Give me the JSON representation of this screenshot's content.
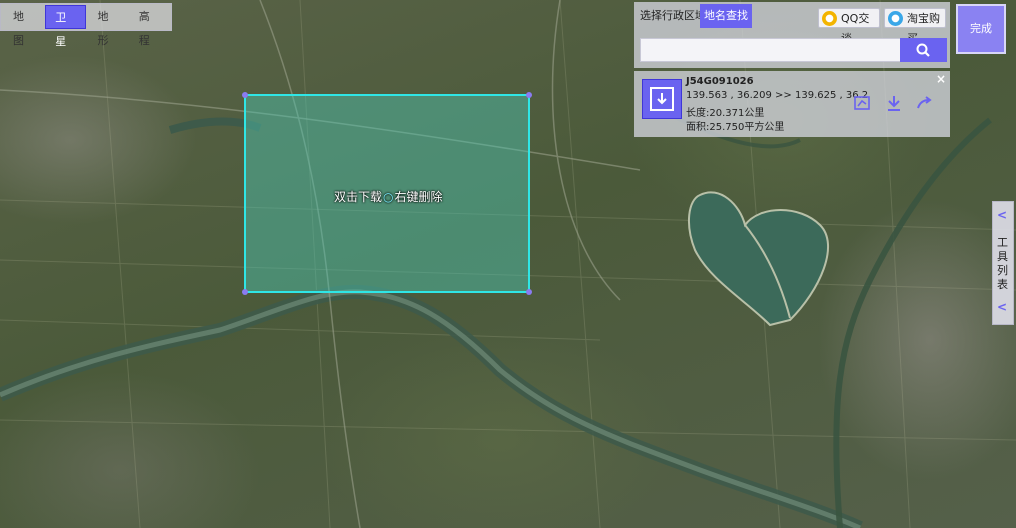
{
  "layer_tabs": [
    {
      "label": "地图",
      "active": false
    },
    {
      "label": "卫星",
      "active": true
    },
    {
      "label": "地形",
      "active": false
    },
    {
      "label": "高程",
      "active": false
    }
  ],
  "selection": {
    "hint_before": "双击下载",
    "hint_after": "右键删除"
  },
  "search_panel": {
    "tabs": [
      "选择行政区域",
      "地名查找"
    ],
    "active_tab": 1,
    "qq_label": "QQ交谈",
    "taobao_label": "淘宝购买",
    "search_placeholder": ""
  },
  "result": {
    "code": "J54G091026",
    "coords": "139.563 , 36.209 >> 139.625 , 36.2",
    "length": "长度:20.371公里",
    "area": "面积:25.750平方公里",
    "close": "×"
  },
  "finish_button": "完成",
  "tools_tab": {
    "label": "工具列表",
    "arrow": "<"
  },
  "colors": {
    "accent": "#6a63f0",
    "selection_border": "#2fe6e6",
    "selection_fill": "#4dc8b4"
  }
}
